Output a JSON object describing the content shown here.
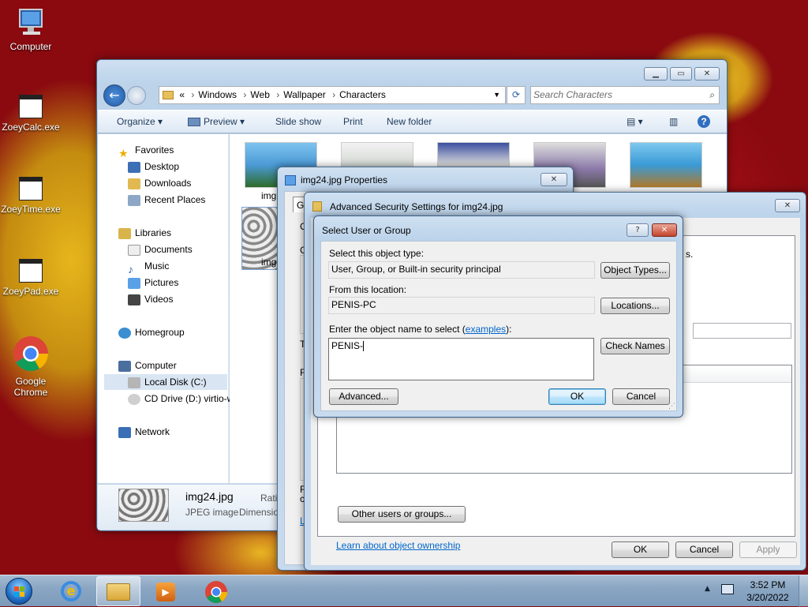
{
  "desktop": {
    "icons": [
      {
        "label": "Computer",
        "icon": "computer-icon"
      },
      {
        "label": "ZoeyCalc.exe",
        "icon": "app-icon"
      },
      {
        "label": "ZoeyTime.exe",
        "icon": "app-icon"
      },
      {
        "label": "ZoeyPad.exe",
        "icon": "app-icon"
      },
      {
        "label": "Google Chrome",
        "icon": "chrome-icon"
      }
    ]
  },
  "explorer": {
    "breadcrumb": [
      "«",
      "Windows",
      "Web",
      "Wallpaper",
      "Characters"
    ],
    "search_placeholder": "Search Characters",
    "toolbar": {
      "organize": "Organize",
      "preview": "Preview",
      "slideshow": "Slide show",
      "print": "Print",
      "new_folder": "New folder"
    },
    "nav": {
      "favorites": "Favorites",
      "desktop": "Desktop",
      "downloads": "Downloads",
      "recent": "Recent Places",
      "libraries": "Libraries",
      "documents": "Documents",
      "music": "Music",
      "pictures": "Pictures",
      "videos": "Videos",
      "homegroup": "Homegroup",
      "computer": "Computer",
      "local_disk": "Local Disk (C:)",
      "cd_drive": "CD Drive (D:) virtio-w",
      "network": "Network"
    },
    "thumb_labels": [
      "img",
      "img"
    ],
    "details": {
      "name": "img24.jpg",
      "type": "JPEG image",
      "rating": "Rati",
      "dimensions": "Dimensio"
    }
  },
  "properties": {
    "title": "img24.jpg Properties",
    "tab": "Ge",
    "frag1": "C",
    "frag2": "G",
    "frag3": "T",
    "frag4": "F",
    "frag5": "F",
    "frag6": "c",
    "frag7": "L"
  },
  "advanced": {
    "title": "Advanced Security Settings for img24.jpg",
    "frag": "s.",
    "other_users": "Other users or groups...",
    "learn": "Learn about object ownership",
    "ok": "OK",
    "cancel": "Cancel",
    "apply": "Apply"
  },
  "select_dialog": {
    "title": "Select User or Group",
    "help": "?",
    "type_label": "Select this object type:",
    "type_value": "User, Group, or Built-in security principal",
    "object_types": "Object Types...",
    "location_label": "From this location:",
    "location_value": "PENIS-PC",
    "locations": "Locations...",
    "name_label_pre": "Enter the object name to select (",
    "name_label_link": "examples",
    "name_label_post": "):",
    "name_value": "PENIS-",
    "check_names": "Check Names",
    "advanced": "Advanced...",
    "ok": "OK",
    "cancel": "Cancel"
  },
  "taskbar": {
    "time": "3:52 PM",
    "date": "3/20/2022"
  }
}
